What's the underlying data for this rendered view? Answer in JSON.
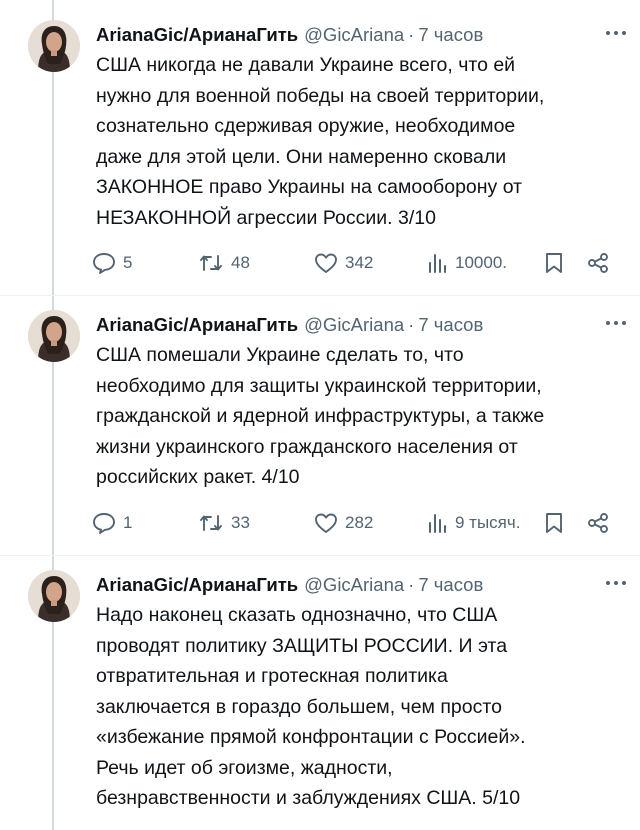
{
  "tweets": [
    {
      "author_name": "ArianaGic/АрианаГить",
      "handle": "@GicAriana",
      "separator": "·",
      "time": "7 часов",
      "text_lines": [
        "США никогда не давали Украине всего, что ей",
        "нужно для военной победы на своей территории,",
        "сознательно сдерживая оружие, необходимое",
        "даже для этой цели. Они намеренно сковали",
        "ЗАКОННОЕ право Украины на самооборону от",
        "НЕЗАКОННОЙ агрессии России. 3/10"
      ],
      "replies": "5",
      "retweets": "48",
      "likes": "342",
      "views": "10000."
    },
    {
      "author_name": "ArianaGic/АрианаГить",
      "handle": "@GicAriana",
      "separator": "·",
      "time": "7 часов",
      "text_lines": [
        "США помешали Украине сделать то, что",
        "необходимо для защиты украинской территории,",
        "гражданской и ядерной инфраструктуры, а также",
        "жизни украинского гражданского населения от",
        "российских ракет. 4/10"
      ],
      "replies": "1",
      "retweets": "33",
      "likes": "282",
      "views": "9 тысяч."
    },
    {
      "author_name": "ArianaGic/АрианаГить",
      "handle": "@GicAriana",
      "separator": "·",
      "time": "7 часов",
      "text_lines": [
        "Надо наконец сказать однозначно, что США",
        "проводят политику ЗАЩИТЫ РОССИИ. И эта",
        "отвратительная и гротескная политика",
        "заключается в гораздо большем, чем просто",
        "«избежание прямой конфронтации с Россией».",
        "Речь идет об эгоизме, жадности,",
        "безнравственности и заблуждениях США. 5/10"
      ]
    }
  ],
  "icons": {
    "more": "more-dots-icon",
    "reply": "reply-bubble-icon",
    "retweet": "retweet-icon",
    "like": "heart-icon",
    "views": "views-chart-icon",
    "bookmark": "bookmark-icon",
    "share": "share-icon"
  },
  "colors": {
    "text": "#0f1419",
    "secondary": "#536471",
    "thread_line": "#cfd9de"
  }
}
